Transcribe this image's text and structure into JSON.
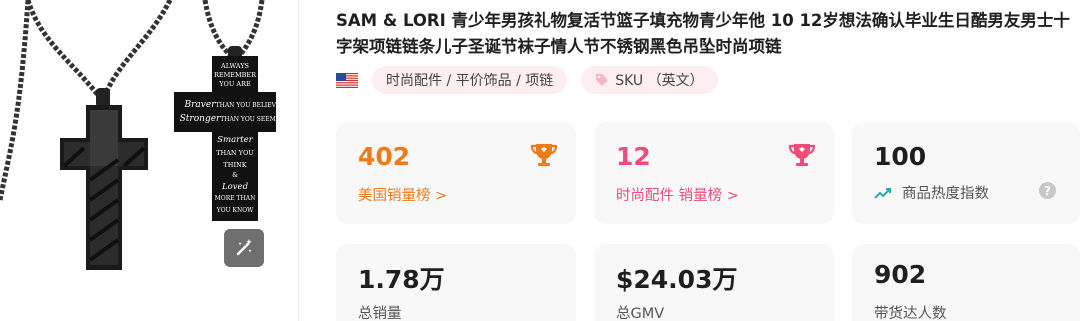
{
  "product": {
    "title": "SAM & LORI 青少年男孩礼物复活节篮子填充物青少年他 10 12岁想法确认毕业生日酷男友男士十字架项链链条儿子圣诞节袜子情人节不锈钢黑色吊坠时尚项链",
    "image_text_left": "",
    "image_text_right": [
      "ALWAYS",
      "REMEMBER",
      "YOU ARE",
      "Braver",
      "THAN YOU BELIEVE",
      "Stronger",
      "THAN YOU SEEM",
      "Smarter",
      "THAN YOU",
      "THINK",
      "&",
      "Loved",
      "MORE THAN",
      "YOU KNOW"
    ]
  },
  "tags": {
    "flag_icon": "us-flag-icon",
    "category": "时尚配件 / 平价饰品 / 项链",
    "sku_label": "SKU （英文）",
    "sku_icon": "tag-icon"
  },
  "stats": {
    "us_rank": {
      "value": "402",
      "label": "美国销量榜 >",
      "color": "#f07a18",
      "icon": "trophy-icon"
    },
    "category_rank": {
      "value": "12",
      "label": "时尚配件 销量榜 >",
      "color": "#ee4c7a",
      "icon": "trophy-icon"
    },
    "heat": {
      "value": "100",
      "label": "商品热度指数",
      "icon": "trend-icon",
      "help_icon": "question-icon"
    },
    "total_sales": {
      "value": "1.78万",
      "label": "总销量"
    },
    "gmv": {
      "value": "$24.03万",
      "label": "总GMV"
    },
    "influencers": {
      "value": "902",
      "label": "带货达人数"
    }
  },
  "colors": {
    "accent_orange": "#f07a18",
    "accent_pink": "#ee4c7a",
    "tag_bg": "#fdeef1",
    "card_bg": "#f8f8f8"
  }
}
